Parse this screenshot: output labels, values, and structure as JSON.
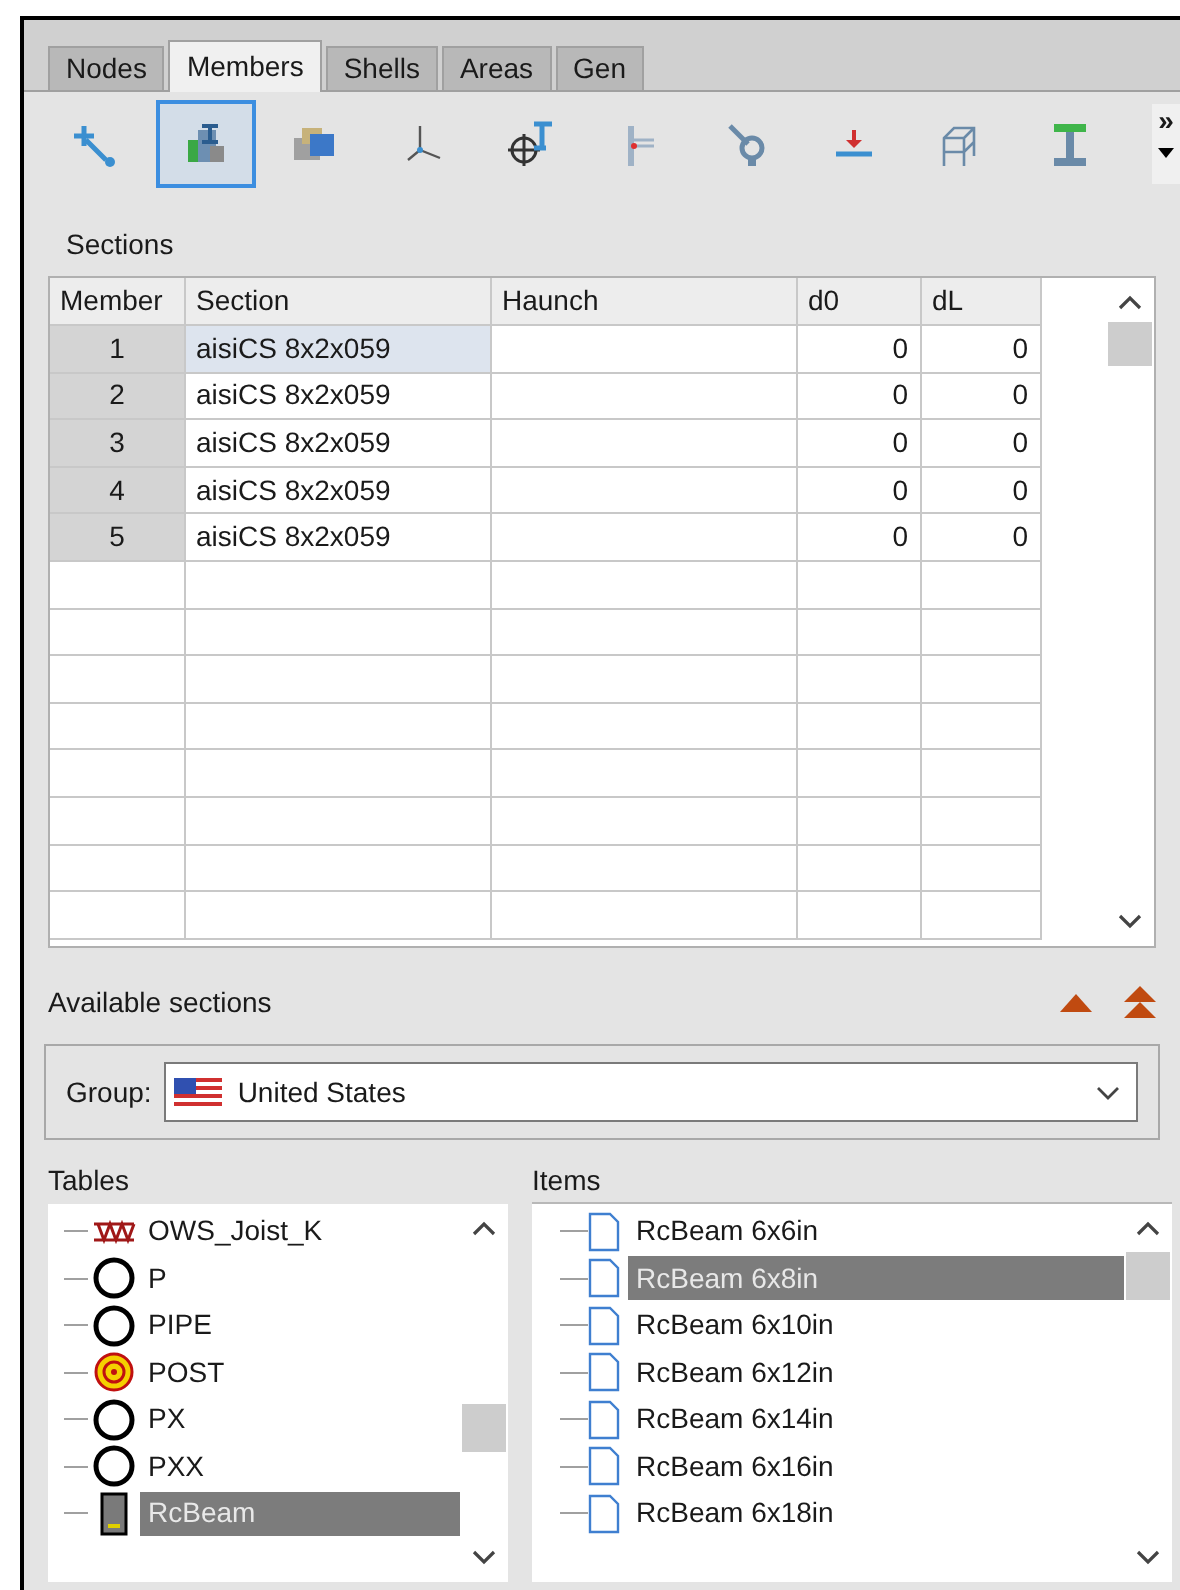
{
  "tabs": [
    {
      "label": "Nodes",
      "selected": false
    },
    {
      "label": "Members",
      "selected": true
    },
    {
      "label": "Shells",
      "selected": false
    },
    {
      "label": "Areas",
      "selected": false
    },
    {
      "label": "Gen",
      "selected": false
    }
  ],
  "toolbar": {
    "tools": [
      {
        "kind": "node-pick",
        "selected": false
      },
      {
        "kind": "section",
        "selected": true
      },
      {
        "kind": "material",
        "selected": false
      },
      {
        "kind": "axes",
        "selected": false
      },
      {
        "kind": "target",
        "selected": false
      },
      {
        "kind": "offset",
        "selected": false
      },
      {
        "kind": "release",
        "selected": false
      },
      {
        "kind": "load",
        "selected": false
      },
      {
        "kind": "frame",
        "selected": false
      },
      {
        "kind": "ibeam",
        "selected": false
      }
    ],
    "overflow": "»"
  },
  "sections": {
    "title": "Sections",
    "columns": [
      "Member",
      "Section",
      "Haunch",
      "d0",
      "dL"
    ],
    "rows": [
      {
        "member": "1",
        "section": "aisiCS 8x2x059",
        "d0": "0",
        "dL": "0",
        "selected": true
      },
      {
        "member": "2",
        "section": "aisiCS 8x2x059",
        "d0": "0",
        "dL": "0",
        "selected": false
      },
      {
        "member": "3",
        "section": "aisiCS 8x2x059",
        "d0": "0",
        "dL": "0",
        "selected": false
      },
      {
        "member": "4",
        "section": "aisiCS 8x2x059",
        "d0": "0",
        "dL": "0",
        "selected": false
      },
      {
        "member": "5",
        "section": "aisiCS 8x2x059",
        "d0": "0",
        "dL": "0",
        "selected": false
      }
    ]
  },
  "available": {
    "title": "Available sections",
    "group_label": "Group:",
    "group_value": "United States",
    "tables_title": "Tables",
    "tables": [
      {
        "label": "OWS_Joist_K",
        "kind": "joist",
        "selected": false
      },
      {
        "label": "P",
        "kind": "circle",
        "selected": false
      },
      {
        "label": "PIPE",
        "kind": "circle",
        "selected": false
      },
      {
        "label": "POST",
        "kind": "post",
        "selected": false
      },
      {
        "label": "PX",
        "kind": "circle",
        "selected": false
      },
      {
        "label": "PXX",
        "kind": "circle",
        "selected": false
      },
      {
        "label": "RcBeam",
        "kind": "beam",
        "selected": true
      }
    ],
    "items_title": "Items",
    "items": [
      {
        "label": "RcBeam 6x6in",
        "selected": false
      },
      {
        "label": "RcBeam 6x8in",
        "selected": true
      },
      {
        "label": "RcBeam 6x10in",
        "selected": false
      },
      {
        "label": "RcBeam 6x12in",
        "selected": false
      },
      {
        "label": "RcBeam 6x14in",
        "selected": false
      },
      {
        "label": "RcBeam 6x16in",
        "selected": false
      },
      {
        "label": "RcBeam 6x18in",
        "selected": false
      }
    ]
  }
}
